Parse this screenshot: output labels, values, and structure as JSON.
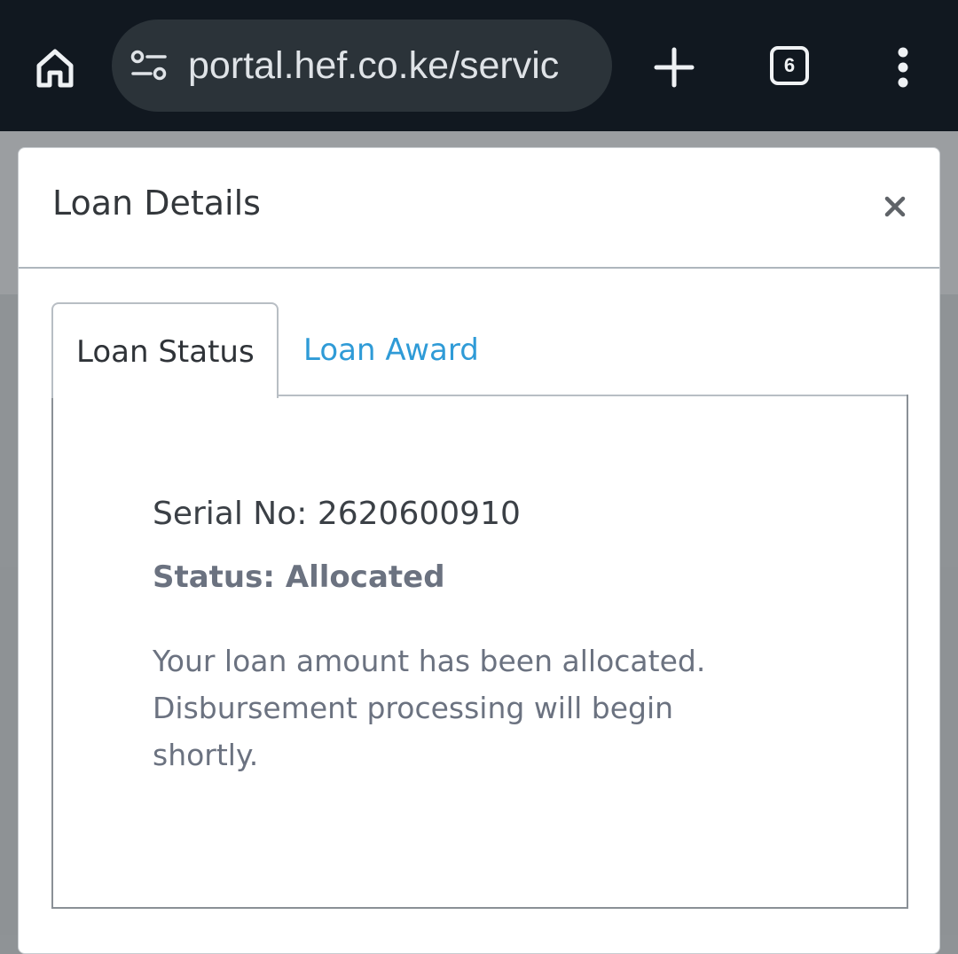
{
  "browser": {
    "url": "portal.hef.co.ke/servic",
    "tab_count": "6",
    "icons": {
      "home": "home-icon",
      "site_settings": "tune-icon",
      "new_tab": "plus-icon",
      "menu": "more-vert-icon"
    }
  },
  "modal": {
    "title": "Loan Details",
    "close_icon": "close-icon",
    "tabs": [
      {
        "label": "Loan Status",
        "active": true
      },
      {
        "label": "Loan Award",
        "active": false
      }
    ],
    "pane": {
      "serial": "Serial No: 2620600910",
      "status": "Status: Allocated",
      "message": "Your loan amount has been allocated. Disbursement processing will begin shortly."
    }
  },
  "colors": {
    "browser_bar": "#111820",
    "url_pill": "#2b3339",
    "tab_link": "#2f9bd7",
    "muted_text": "#6b7280"
  }
}
